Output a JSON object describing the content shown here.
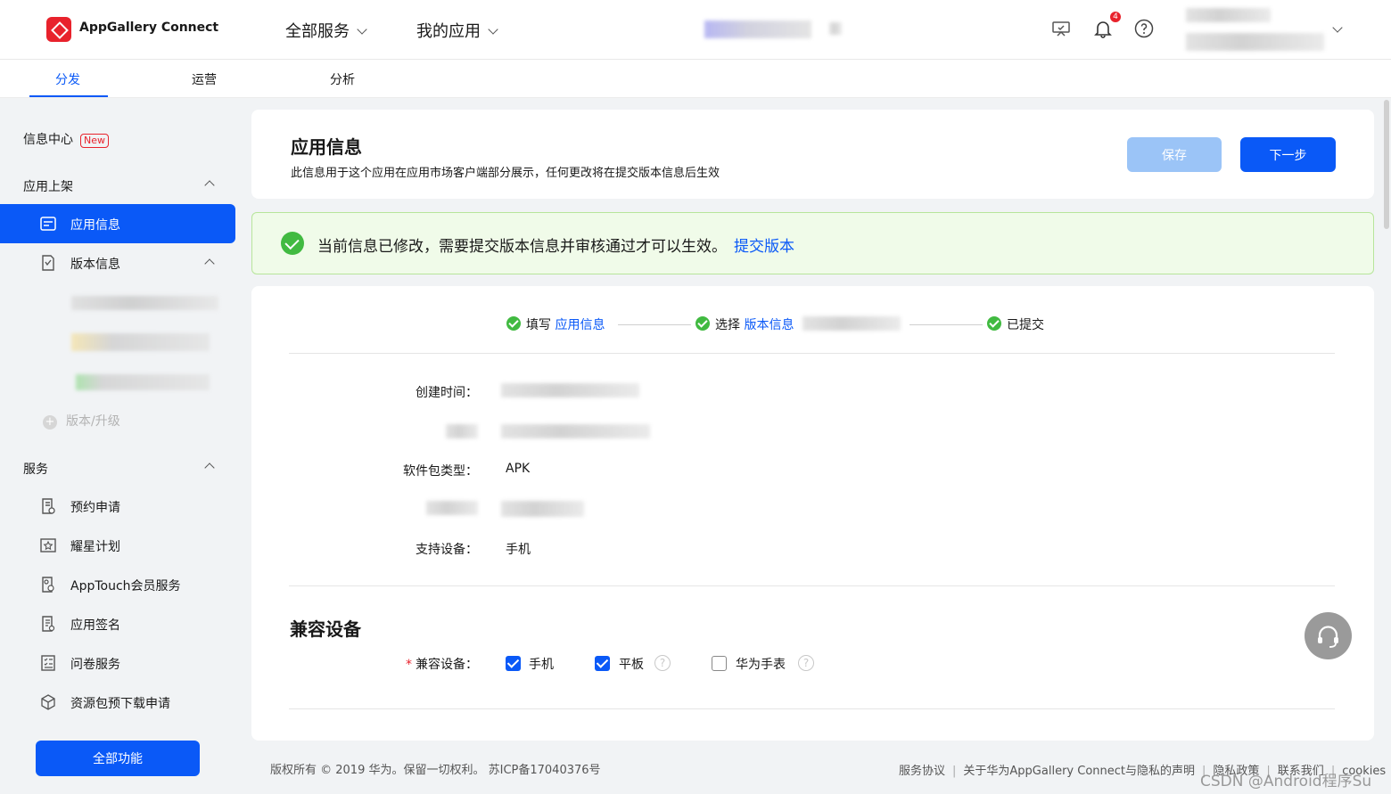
{
  "header": {
    "brand": "AppGallery Connect",
    "nav": [
      {
        "label": "全部服务"
      },
      {
        "label": "我的应用"
      }
    ],
    "notification_count": "4"
  },
  "subtabs": [
    {
      "label": "分发",
      "active": true
    },
    {
      "label": "运营"
    },
    {
      "label": "分析"
    }
  ],
  "sidebar": {
    "info_center": "信息中心",
    "new_tag": "New",
    "section_release": "应用上架",
    "app_info": "应用信息",
    "version_info": "版本信息",
    "add_version": "版本/升级",
    "section_services": "服务",
    "services": [
      {
        "label": "预约申请",
        "icon": "calendar-doc-icon"
      },
      {
        "label": "耀星计划",
        "icon": "star-frame-icon"
      },
      {
        "label": "AppTouch会员服务",
        "icon": "member-icon"
      },
      {
        "label": "应用签名",
        "icon": "signature-icon"
      },
      {
        "label": "问卷服务",
        "icon": "checklist-icon"
      },
      {
        "label": "资源包预下载申请",
        "icon": "package-icon"
      }
    ],
    "all_functions": "全部功能"
  },
  "main": {
    "title": "应用信息",
    "description": "此信息用于这个应用在应用市场客户端部分展示，任何更改将在提交版本信息后生效",
    "save_label": "保存",
    "next_label": "下一步",
    "alert_text": "当前信息已修改，需要提交版本信息并审核通过才可以生效。",
    "alert_link": "提交版本",
    "steps": {
      "step1_prefix": "填写",
      "step1_link": "应用信息",
      "step2_prefix": "选择",
      "step2_link": "版本信息",
      "step3": "已提交"
    },
    "fields": {
      "created_label": "创建时间：",
      "package_type_label": "软件包类型：",
      "package_type_value": "APK",
      "devices_label": "支持设备：",
      "devices_value": "手机"
    },
    "compat": {
      "section_title": "兼容设备",
      "label": "兼容设备：",
      "phone": "手机",
      "tablet": "平板",
      "watch": "华为手表",
      "help_glyph": "?"
    }
  },
  "footer": {
    "copyright": "版权所有 © 2019 华为。保留一切权利。 苏ICP备17040376号",
    "links": [
      "服务协议",
      "关于华为AppGallery Connect与隐私的声明",
      "隐私政策",
      "联系我们",
      "cookies"
    ],
    "watermark": "CSDN @Android程序Su"
  },
  "colors": {
    "accent": "#0a59f7",
    "success": "#41ba41",
    "danger": "#e8222c"
  }
}
